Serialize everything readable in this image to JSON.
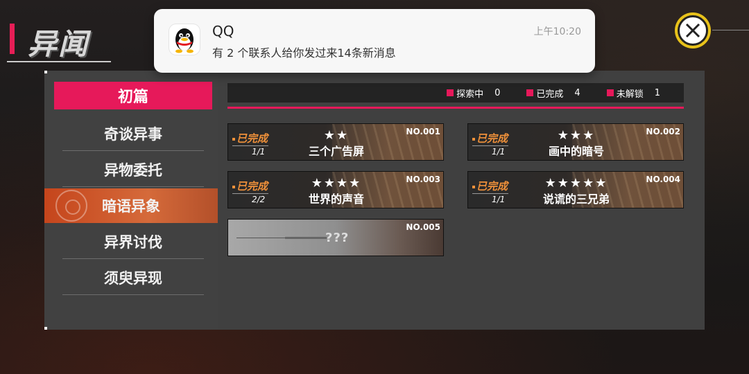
{
  "header": {
    "title": "异闻"
  },
  "notification": {
    "app_icon": "qq-penguin-icon",
    "app_name": "QQ",
    "message": "有 2 个联系人给你发过来14条新消息",
    "time": "上午10:20"
  },
  "sidebar": {
    "header": "初篇",
    "items": [
      {
        "label": "奇谈异事",
        "active": false
      },
      {
        "label": "异物委托",
        "active": false
      },
      {
        "label": "暗语异象",
        "active": true
      },
      {
        "label": "异界讨伐",
        "active": false
      },
      {
        "label": "须臾异现",
        "active": false
      }
    ]
  },
  "status_bar": {
    "exploring_label": "探索中",
    "exploring_count": "0",
    "completed_label": "已完成",
    "completed_count": "4",
    "locked_label": "未解锁",
    "locked_count": "1"
  },
  "cards": [
    {
      "no": "NO.001",
      "status": "已完成",
      "progress": "1/1",
      "stars": 2,
      "name": "三个广告屏"
    },
    {
      "no": "NO.002",
      "status": "已完成",
      "progress": "1/1",
      "stars": 3,
      "name": "画中的暗号"
    },
    {
      "no": "NO.003",
      "status": "已完成",
      "progress": "2/2",
      "stars": 4,
      "name": "世界的声音"
    },
    {
      "no": "NO.004",
      "status": "已完成",
      "progress": "1/1",
      "stars": 5,
      "name": "说谎的三兄弟"
    },
    {
      "no": "NO.005",
      "locked": true,
      "name": "???"
    }
  ],
  "colors": {
    "accent": "#e6195a",
    "completed": "#f0913a",
    "active_tab": "#c5451c",
    "close_ring": "#e8c21a"
  }
}
